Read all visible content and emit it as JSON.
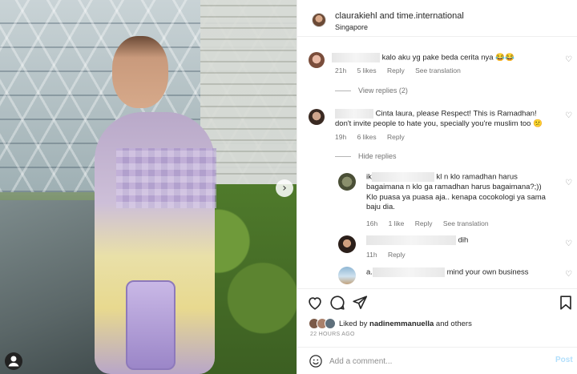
{
  "post": {
    "username": "claurakiehl and time.international",
    "location": "Singapore"
  },
  "comments": [
    {
      "text": "kalo aku yg pake beda cerita nya 😂😂",
      "time": "21h",
      "likes": "5 likes",
      "reply": "Reply",
      "translation": "See translation",
      "toggle": "View replies (2)"
    },
    {
      "text_line1": "Cinta laura, please Respect! This is Ramadhan!",
      "text_line2": "don't invite people to hate you, specially you're muslim too 😕",
      "time": "19h",
      "likes": "6 likes",
      "reply": "Reply",
      "toggle": "Hide replies"
    }
  ],
  "replies": [
    {
      "prefix": "ik",
      "text_line1_end": "kl n klo ramadhan harus",
      "text_line2": "bagaimana n klo ga ramadhan harus bagaimana?;))",
      "text_line3": "Klo puasa ya puasa aja.. kenapa cocokologi ya sama",
      "text_line4": "baju dia.",
      "time": "16h",
      "likes": "1 like",
      "reply": "Reply",
      "translation": "See translation"
    },
    {
      "text": "dih",
      "time": "11h",
      "reply": "Reply"
    },
    {
      "prefix": "a.",
      "text": "mind your own business"
    }
  ],
  "liked_by": {
    "prefix": "Liked by",
    "user": "nadinemmanuella",
    "suffix": "and others"
  },
  "time_ago": "22 HOURS AGO",
  "add_comment": {
    "placeholder": "Add a comment...",
    "post_label": "Post"
  },
  "icons": {
    "photo_arrow": "chevron-right-icon",
    "tag": "user-tag-icon",
    "heart": "heart-icon",
    "comment": "comment-icon",
    "share": "share-icon",
    "save": "bookmark-icon",
    "emoji": "smiley-icon"
  },
  "colors": {
    "link_blue": "#b2dffc",
    "muted": "#737373",
    "text": "#262626"
  }
}
